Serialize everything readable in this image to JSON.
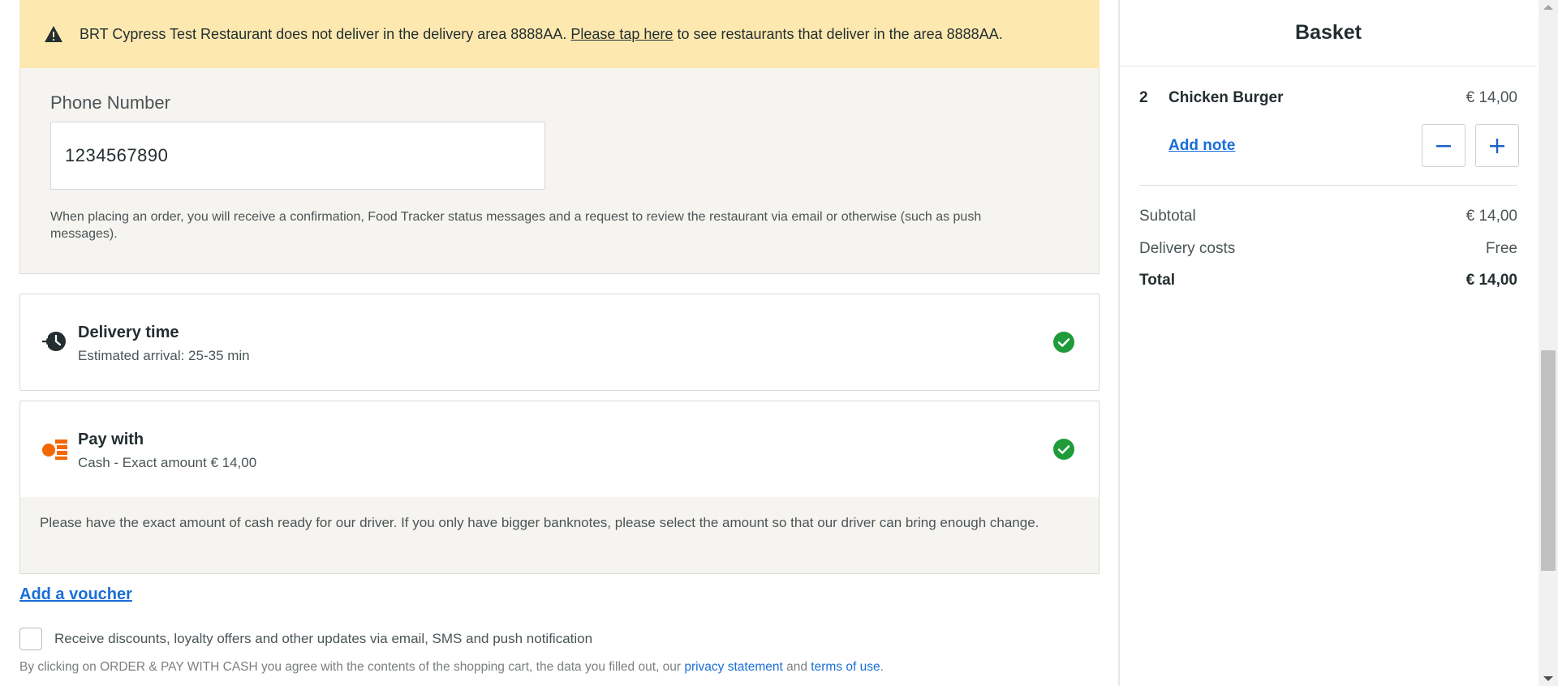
{
  "warning": {
    "text_before": "BRT Cypress Test Restaurant does not deliver in the delivery area 8888AA.",
    "link": "Please tap here",
    "text_after": "to see restaurants that deliver in the area 8888AA.",
    "icon": "warning-triangle-icon"
  },
  "phone": {
    "label": "Phone Number",
    "value": "1234567890",
    "note": "When placing an order, you will receive a confirmation, Food Tracker status messages and a request to review the restaurant via email or otherwise (such as push messages)."
  },
  "delivery": {
    "title": "Delivery time",
    "subtitle": "Estimated arrival: 25-35 min",
    "icon": "clock-speed-icon"
  },
  "payment": {
    "title": "Pay with",
    "subtitle": "Cash - Exact amount € 14,00",
    "note": "Please have the exact amount of cash ready for our driver. If you only have bigger banknotes, please select the amount so that our driver can bring enough change.",
    "icon": "cash-icon"
  },
  "voucher": {
    "label": "Add a voucher"
  },
  "marketing": {
    "label": "Receive discounts, loyalty offers and other updates via email, SMS and push notification"
  },
  "terms": {
    "text_before": "By clicking on ORDER & PAY WITH CASH you agree with the contents of the shopping cart, the data you filled out, our",
    "privacy_link": "privacy statement",
    "and": "and",
    "terms_link": "terms of use",
    "period": "."
  },
  "basket": {
    "title": "Basket",
    "items": [
      {
        "qty": "2",
        "name": "Chicken Burger",
        "price": "€ 14,00",
        "add_note": "Add note"
      }
    ],
    "subtotal_label": "Subtotal",
    "subtotal_value": "€ 14,00",
    "delivery_label": "Delivery costs",
    "delivery_value": "Free",
    "total_label": "Total",
    "total_value": "€ 14,00"
  },
  "colors": {
    "warning_bg": "#fde9b0",
    "panel_bg": "#f6f4f0",
    "link_blue": "#1a6ed8",
    "success_green": "#1f9b3a",
    "cash_orange": "#f36805"
  }
}
